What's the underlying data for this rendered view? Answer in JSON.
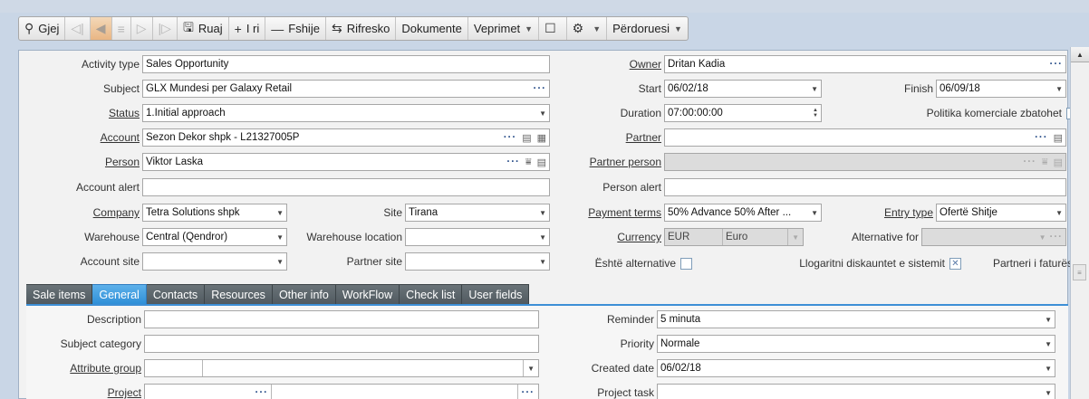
{
  "toolbar": {
    "search_label": "Gjej",
    "save_label": "Ruaj",
    "new_label": "I ri",
    "delete_label": "Fshije",
    "refresh_label": "Rifresko",
    "documents_label": "Dokumente",
    "actions_label": "Veprimet",
    "user_label": "Përdoruesi"
  },
  "form": {
    "activity_type_label": "Activity type",
    "activity_type_value": "Sales Opportunity",
    "subject_label": "Subject",
    "subject_value": "GLX Mundesi per Galaxy Retail",
    "status_label": "Status",
    "status_value": "1.Initial approach",
    "account_label": "Account",
    "account_value": "Sezon Dekor shpk - L21327005P",
    "person_label": "Person",
    "person_value": "Viktor Laska",
    "account_alert_label": "Account alert",
    "account_alert_value": "",
    "company_label": "Company",
    "company_value": "Tetra Solutions shpk",
    "site_label": "Site",
    "site_value": "Tirana",
    "warehouse_label": "Warehouse",
    "warehouse_value": "Central (Qendror)",
    "warehouse_location_label": "Warehouse location",
    "warehouse_location_value": "",
    "account_site_label": "Account site",
    "account_site_value": "",
    "partner_site_label": "Partner site",
    "partner_site_value": "",
    "owner_label": "Owner",
    "owner_value": "Dritan Kadia",
    "start_label": "Start",
    "start_value": "06/02/18",
    "finish_label": "Finish",
    "finish_value": "06/09/18",
    "duration_label": "Duration",
    "duration_value": "07:00:00:00",
    "commercial_policy_label": "Politika komerciale zbatohet",
    "partner_label": "Partner",
    "partner_value": "",
    "partner_person_label": "Partner person",
    "partner_person_value": "",
    "person_alert_label": "Person alert",
    "person_alert_value": "",
    "payment_terms_label": "Payment terms",
    "payment_terms_value": "50% Advance 50% After ...",
    "entry_type_label": "Entry type",
    "entry_type_value": "Ofertë  Shitje",
    "currency_label": "Currency",
    "currency_code": "EUR",
    "currency_name": "Euro",
    "alternative_for_label": "Alternative for",
    "alternative_for_value": "",
    "is_alternative_label": "Është alternative",
    "system_discounts_label": "Llogaritni diskauntet e sistemit",
    "invoice_partner_label": "Partneri i faturës"
  },
  "tabs": [
    "Sale items",
    "General",
    "Contacts",
    "Resources",
    "Other info",
    "WorkFlow",
    "Check list",
    "User fields"
  ],
  "active_tab": "General",
  "general": {
    "description_label": "Description",
    "description_value": "",
    "subject_category_label": "Subject category",
    "subject_category_value": "",
    "attribute_group_label": "Attribute group",
    "attribute_group_value": "",
    "project_label": "Project",
    "project_value": "",
    "reminder_label": "Reminder",
    "reminder_value": "5 minuta",
    "priority_label": "Priority",
    "priority_value": "Normale",
    "created_date_label": "Created date",
    "created_date_value": "06/02/18",
    "project_task_label": "Project task",
    "project_task_value": ""
  },
  "checkboxes": {
    "commercial_policy": false,
    "is_alternative": false,
    "system_discounts": true,
    "invoice_partner": false
  },
  "colors": {
    "accent": "#3d8fd6",
    "tab_dark": "#555f65",
    "toolbar_active": "#e9b684",
    "link_blue": "#2a4f8a"
  }
}
